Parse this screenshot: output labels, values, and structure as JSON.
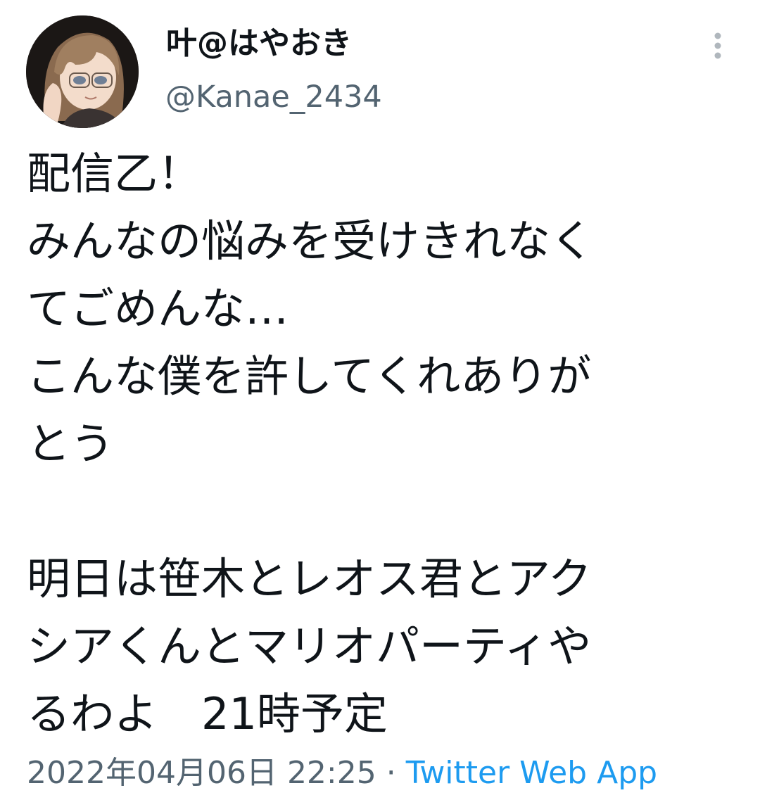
{
  "author": {
    "display_name": "叶@はやおき",
    "handle": "@Kanae_2434",
    "avatar_icon": "user-avatar-icon"
  },
  "more_icon": "more-vertical-icon",
  "tweet": {
    "lines": [
      "配信乙！",
      "みんなの悩みを受けきれなく",
      "てごめんな…",
      "こんな僕を許してくれありが",
      "とう",
      "",
      "明日は笹木とレオス君とアク",
      "シアくんとマリオパーティや",
      "るわよ　21時予定"
    ]
  },
  "meta": {
    "datetime": "2022年04月06日 22:25",
    "separator": " · ",
    "source": "Twitter Web App"
  },
  "colors": {
    "text": "#0f1419",
    "secondary": "#536471",
    "link": "#1d9bf0"
  }
}
